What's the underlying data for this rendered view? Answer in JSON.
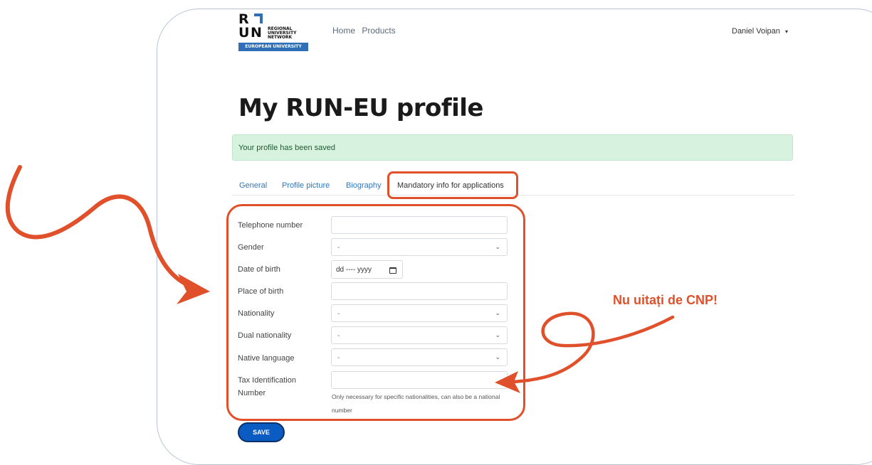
{
  "header": {
    "logo": {
      "letters_top": "R",
      "letters_bottom_u": "U",
      "letters_bottom_n": "N",
      "text": "REGIONAL UNIVERSITY NETWORK",
      "band": "EUROPEAN UNIVERSITY"
    },
    "nav": [
      "Home",
      "Products"
    ],
    "user_name": "Daniel Voipan",
    "user_caret": "▾"
  },
  "page": {
    "title": "My RUN-EU profile"
  },
  "alert": {
    "message": "Your profile has been saved"
  },
  "tabs": [
    {
      "label": "General"
    },
    {
      "label": "Profile picture"
    },
    {
      "label": "Biography"
    },
    {
      "label": "Mandatory info for applications",
      "active": true
    }
  ],
  "form": {
    "telephone_label": "Telephone number",
    "telephone_value": "",
    "gender_label": "Gender",
    "gender_value": "-",
    "dob_label": "Date of birth",
    "dob_value": "dd ---- yyyy",
    "place_label": "Place of birth",
    "place_value": "",
    "nationality_label": "Nationality",
    "nationality_value": "-",
    "dual_label": "Dual nationality",
    "dual_value": "-",
    "native_label": "Native language",
    "native_value": "-",
    "tax_label_line1": "Tax Identification",
    "tax_label_line2": "Number",
    "tax_value": "",
    "tax_help": "Only necessary for specific nationalities, can also be a national number"
  },
  "save_label": "SAVE",
  "annotation": {
    "text": "Nu uitați de CNP!",
    "color": "#e0502a"
  },
  "colors": {
    "accent": "#e0502a",
    "link": "#2e77c2",
    "button": "#0a5cc2",
    "alert_bg": "#d7f3df",
    "brand_blue": "#2e6fb7"
  },
  "icons": [
    "chevron-down-icon",
    "calendar-icon",
    "caret-down-icon"
  ]
}
